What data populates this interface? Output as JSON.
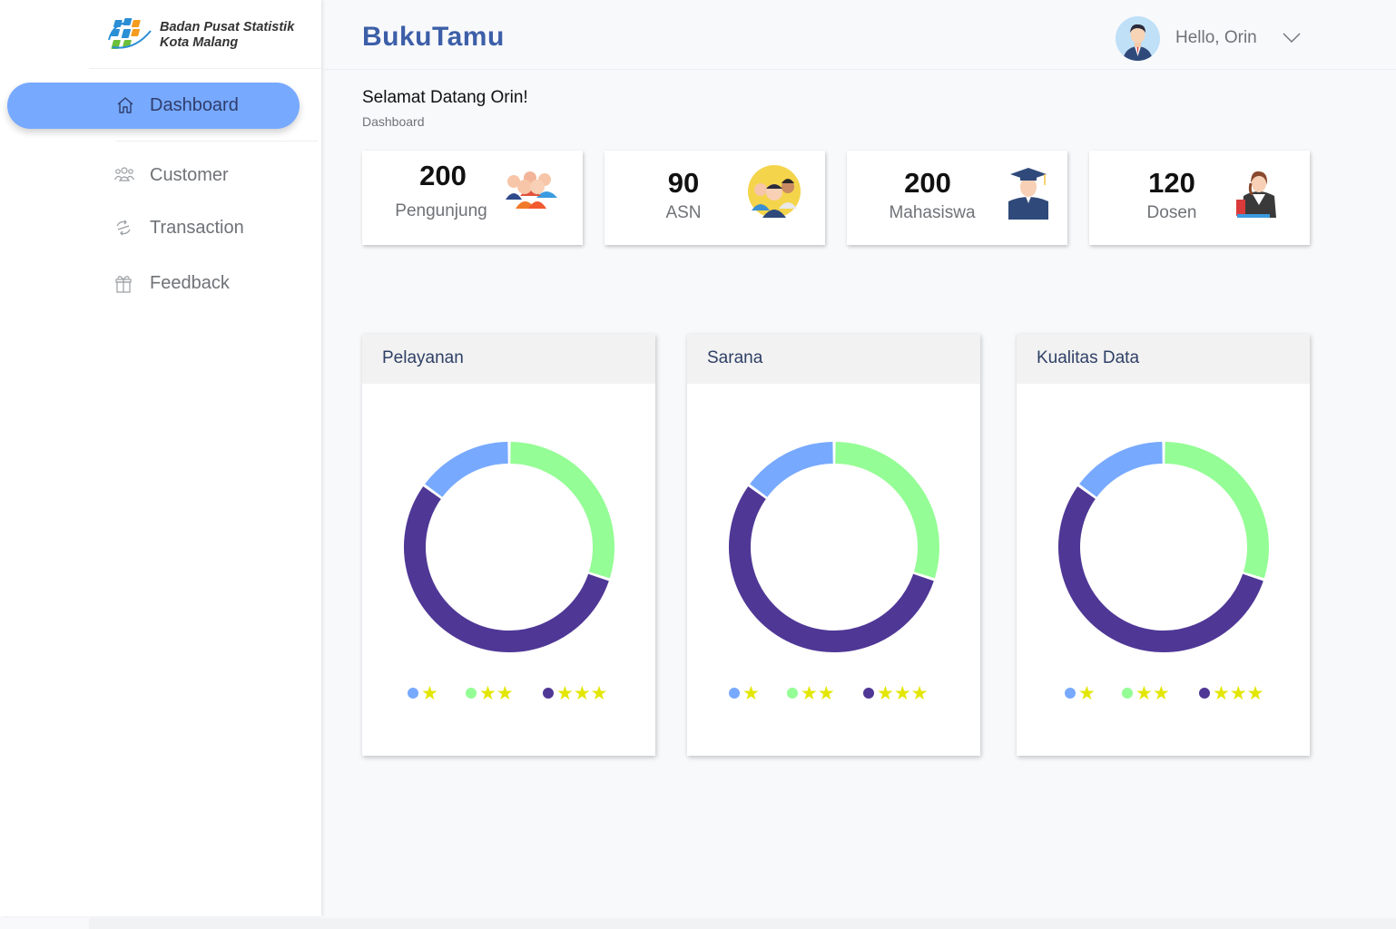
{
  "org": {
    "line1": "Badan Pusat Statistik",
    "line2": "Kota Malang"
  },
  "brand": "BukuTamu",
  "user": {
    "greeting": "Hello, Orin"
  },
  "nav": {
    "active": {
      "label": "Dashboard",
      "icon": "home-icon"
    },
    "items": [
      {
        "label": "Customer",
        "icon": "users-icon"
      },
      {
        "label": "Transaction",
        "icon": "exchange-icon"
      },
      {
        "label": "Feedback",
        "icon": "gift-icon"
      }
    ]
  },
  "page": {
    "welcome": "Selamat Datang Orin!",
    "breadcrumb": "Dashboard"
  },
  "stats": [
    {
      "value": "200",
      "label": "Pengunjung",
      "icon": "group-icon"
    },
    {
      "value": "90",
      "label": "ASN",
      "icon": "officials-icon"
    },
    {
      "value": "200",
      "label": "Mahasiswa",
      "icon": "graduate-icon"
    },
    {
      "value": "120",
      "label": "Dosen",
      "icon": "teacher-icon"
    }
  ],
  "colors": {
    "one_star": "#77a9ff",
    "two_star": "#94fd95",
    "three_star": "#4f3796",
    "star": "#e3e600",
    "accent": "#77a9ff",
    "brand": "#3d5fa8"
  },
  "legend": [
    {
      "stars": "★",
      "color": "#77a9ff"
    },
    {
      "stars": "★★",
      "color": "#94fd95"
    },
    {
      "stars": "★★★",
      "color": "#4f3796"
    }
  ],
  "ratings": [
    {
      "title": "Pelayanan"
    },
    {
      "title": "Sarana"
    },
    {
      "title": "Kualitas Data"
    }
  ],
  "chart_data": [
    {
      "type": "pie",
      "title": "Pelayanan",
      "categories": [
        "★",
        "★★",
        "★★★"
      ],
      "values": [
        15,
        30,
        55
      ]
    },
    {
      "type": "pie",
      "title": "Sarana",
      "categories": [
        "★",
        "★★",
        "★★★"
      ],
      "values": [
        15,
        30,
        55
      ]
    },
    {
      "type": "pie",
      "title": "Kualitas Data",
      "categories": [
        "★",
        "★★",
        "★★★"
      ],
      "values": [
        15,
        30,
        55
      ]
    }
  ]
}
